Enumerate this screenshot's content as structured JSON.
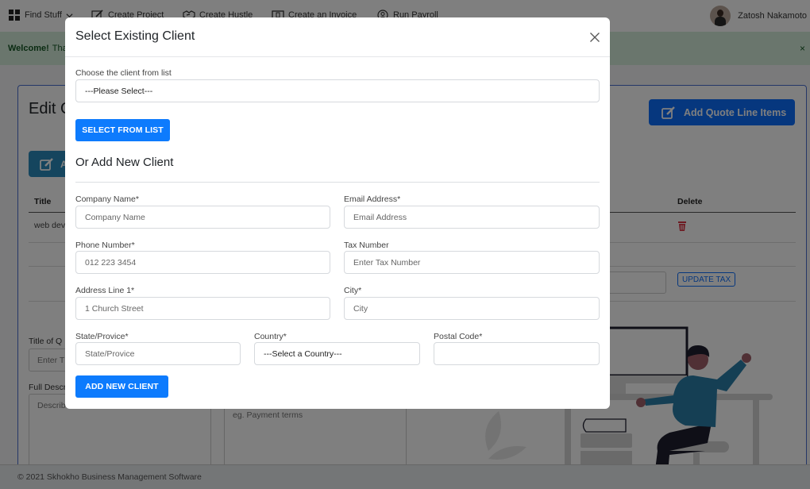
{
  "nav": {
    "items": [
      {
        "label": "Find Stuff",
        "icon": "grid-icon"
      },
      {
        "label": "Create Project",
        "icon": "pencil-square-icon"
      },
      {
        "label": "Create Hustle",
        "icon": "handshake-icon"
      },
      {
        "label": "Create an Invoice",
        "icon": "invoice-icon"
      },
      {
        "label": "Run Payroll",
        "icon": "payroll-icon"
      }
    ],
    "user_name": "Zatosh Nakamoto"
  },
  "banner": {
    "strong": "Welcome!",
    "text": "Tha",
    "close": "×"
  },
  "page": {
    "title": "Edit Q",
    "add_quote_button": "Add Quote Line Items",
    "teal_button": "A",
    "table": {
      "headers": {
        "title": "Title",
        "delete": "Delete"
      },
      "rows": [
        {
          "title": "web dev"
        }
      ]
    },
    "update_tax_button": "UPDATE TAX",
    "title_of_quote_label": "Title of Q",
    "title_of_quote_placeholder": "Enter T",
    "full_description_label": "Full Descr",
    "full_description_placeholder": "Describ",
    "terms_placeholder": "eg. Payment terms",
    "footer": "© 2021 Skhokho Business Management Software"
  },
  "colors": {
    "primary": "#0d7bfd",
    "danger": "#dc3545",
    "success_bg": "#d4edda"
  },
  "modal": {
    "title": "Select Existing Client",
    "close_label": "×",
    "choose_label": "Choose the client from list",
    "choose_select_value": "---Please Select---",
    "select_from_list_button": "SELECT FROM LIST",
    "add_new_heading": "Or Add New Client",
    "fields": {
      "company_name": {
        "label": "Company Name*",
        "placeholder": "Company Name"
      },
      "email": {
        "label": "Email Address*",
        "placeholder": "Email Address"
      },
      "phone": {
        "label": "Phone Number*",
        "placeholder": "012 223 3454"
      },
      "tax_number": {
        "label": "Tax Number",
        "placeholder": "Enter Tax Number"
      },
      "address_line_1": {
        "label": "Address Line 1*",
        "placeholder": "1 Church Street"
      },
      "city": {
        "label": "City*",
        "placeholder": "City"
      },
      "state": {
        "label": "State/Provice*",
        "placeholder": "State/Provice"
      },
      "country": {
        "label": "Country*",
        "value": "---Select a Country---"
      },
      "postal_code": {
        "label": "Postal Code*",
        "placeholder": ""
      }
    },
    "add_new_client_button": "ADD NEW CLIENT"
  }
}
